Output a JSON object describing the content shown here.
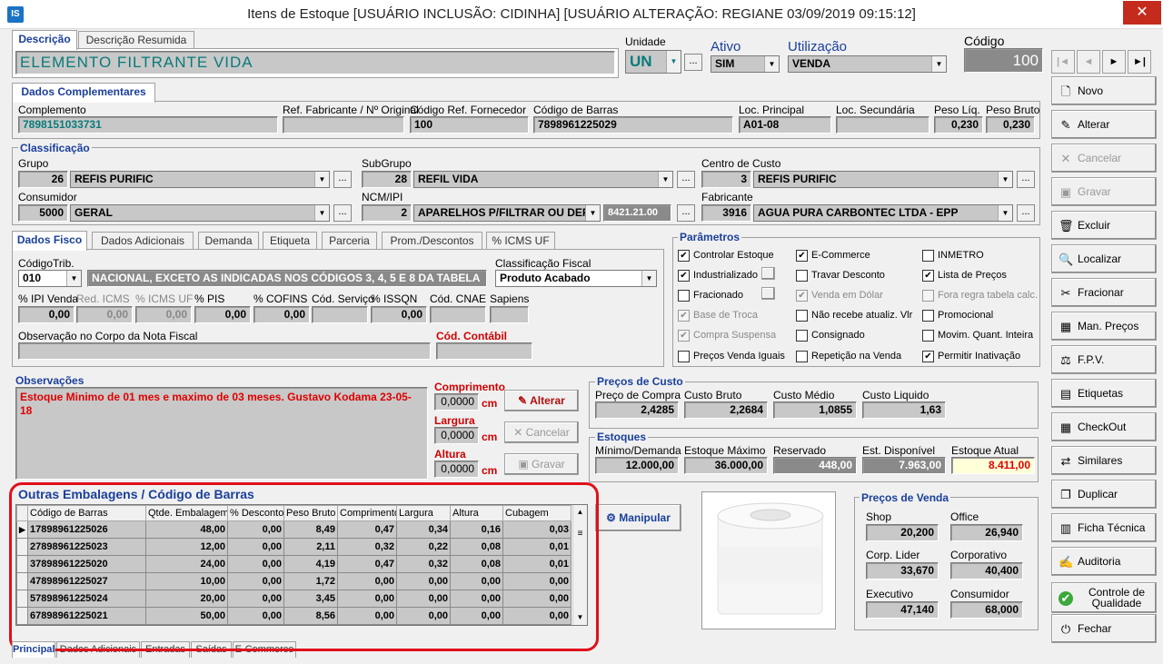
{
  "window": {
    "title": "Itens de Estoque  [USUÁRIO INCLUSÃO: CIDINHA]  [USUÁRIO ALTERAÇÃO: REGIANE 03/09/2019 09:15:12]",
    "icon_label": "IS",
    "close": "✕"
  },
  "header": {
    "tab_descricao": "Descrição",
    "tab_resumida": "Descrição Resumida",
    "descricao": "ELEMENTO FILTRANTE  VIDA",
    "unidade_label": "Unidade",
    "unidade": "UN",
    "ativo_label": "Ativo",
    "ativo": "SIM",
    "utilizacao_label": "Utilização",
    "utilizacao": "VENDA",
    "codigo_label": "Código",
    "codigo": "100",
    "dots": "..."
  },
  "nav": {
    "first": "|◄",
    "prev": "◄",
    "next": "►",
    "last": "►|"
  },
  "complementares": {
    "tab": "Dados Complementares",
    "complemento_label": "Complemento",
    "complemento": "7898151033731",
    "ref_fab_label": "Ref. Fabricante / Nº Original",
    "ref_fab": "",
    "cod_ref_label": "Código Ref. Fornecedor",
    "cod_ref": "100",
    "barras_label": "Código de Barras",
    "barras": "7898961225029",
    "loc_principal_label": "Loc. Principal",
    "loc_principal": "A01-08",
    "loc_secundaria_label": "Loc. Secundária",
    "loc_secundaria": "",
    "peso_liq_label": "Peso Líq.",
    "peso_liq": "0,230",
    "peso_bruto_label": "Peso Bruto",
    "peso_bruto": "0,230"
  },
  "classificacao": {
    "title": "Classificação",
    "grupo_label": "Grupo",
    "grupo_cod": "26",
    "grupo": "REFIS PURIFIC",
    "subgrupo_label": "SubGrupo",
    "subgrupo_cod": "28",
    "subgrupo": "REFIL VIDA",
    "centro_label": "Centro de Custo",
    "centro_cod": "3",
    "centro": "REFIS PURIFIC",
    "consumidor_label": "Consumidor",
    "consumidor_cod": "5000",
    "consumidor": "GERAL",
    "ncm_label": "NCM/IPI",
    "ncm_cod": "2",
    "ncm": "APARELHOS P/FILTRAR OU DEPURA",
    "ncm_num": "8421.21.00",
    "fabricante_label": "Fabricante",
    "fabricante_cod": "3916",
    "fabricante": "AGUA PURA CARBONTEC LTDA - EPP"
  },
  "fisco": {
    "tabs": [
      "Dados Fisco",
      "Dados Adicionais",
      "Demanda",
      "Etiqueta",
      "Parceria",
      "Prom./Descontos",
      "% ICMS UF"
    ],
    "cod_trib_label": "CódigoTrib.",
    "cod_trib": "010",
    "cod_trib_desc": "NACIONAL, EXCETO AS INDICADAS NOS CÓDIGOS 3, 4, 5 E 8 DA TABELA",
    "class_fiscal_label": "Classificação Fiscal",
    "class_fiscal": "Produto Acabado",
    "ipi_label": "% IPI Venda",
    "ipi": "0,00",
    "red_icms_label": "Red. ICMS",
    "red_icms": "0,00",
    "icms_uf_label": "% ICMS UF",
    "icms_uf": "0,00",
    "pis_label": "% PIS",
    "pis": "0,00",
    "cofins_label": "% COFINS",
    "cofins": "0,00",
    "cod_serv_label": "Cód. Serviço",
    "cod_serv": "",
    "issqn_label": "% ISSQN",
    "issqn": "0,00",
    "cnae_label": "Cód. CNAE",
    "cnae": "",
    "sapiens_label": "Sapiens",
    "sapiens": "",
    "obs_nf_label": "Observação no Corpo da Nota Fiscal",
    "obs_nf": "",
    "cod_contabil_label": "Cód. Contábil",
    "cod_contabil": ""
  },
  "parametros": {
    "title": "Parâmetros",
    "items": [
      {
        "label": "Controlar Estoque",
        "checked": true,
        "disabled": false
      },
      {
        "label": "E-Commerce",
        "checked": true,
        "disabled": false
      },
      {
        "label": "INMETRO",
        "checked": false,
        "disabled": false
      },
      {
        "label": "Industrializado",
        "checked": true,
        "disabled": false
      },
      {
        "label": "Travar Desconto",
        "checked": false,
        "disabled": false
      },
      {
        "label": "Lista de Preços",
        "checked": true,
        "disabled": false
      },
      {
        "label": "Fracionado",
        "checked": false,
        "disabled": false
      },
      {
        "label": "Venda em Dólar",
        "checked": true,
        "disabled": true
      },
      {
        "label": "Fora regra tabela calc.",
        "checked": false,
        "disabled": true
      },
      {
        "label": "Base de Troca",
        "checked": true,
        "disabled": true
      },
      {
        "label": "Não recebe atualiz. Vlr",
        "checked": false,
        "disabled": false
      },
      {
        "label": "Promocional",
        "checked": false,
        "disabled": false
      },
      {
        "label": "Compra Suspensa",
        "checked": true,
        "disabled": true
      },
      {
        "label": "Consignado",
        "checked": false,
        "disabled": false
      },
      {
        "label": "Movim. Quant. Inteira",
        "checked": false,
        "disabled": false
      },
      {
        "label": "Preços Venda Iguais",
        "checked": false,
        "disabled": false
      },
      {
        "label": "Repetição na Venda",
        "checked": false,
        "disabled": false
      },
      {
        "label": "Permitir Inativação",
        "checked": true,
        "disabled": false
      }
    ]
  },
  "observacoes": {
    "title": "Observações",
    "text": "Estoque Minimo de 01 mes e maximo de 03 meses. Gustavo Kodama 23-05-18"
  },
  "dimensoes": {
    "comprimento_label": "Comprimento",
    "comprimento": "0,0000",
    "largura_label": "Largura",
    "largura": "0,0000",
    "altura_label": "Altura",
    "altura": "0,0000",
    "unit": "cm",
    "alterar": "Alterar",
    "cancelar": "Cancelar",
    "gravar": "Gravar"
  },
  "custo": {
    "title": "Preços de Custo",
    "compra_label": "Preço de Compra",
    "compra": "2,4285",
    "bruto_label": "Custo Bruto",
    "bruto": "2,2684",
    "medio_label": "Custo Médio",
    "medio": "1,0855",
    "liquido_label": "Custo Liquido",
    "liquido": "1,63"
  },
  "estoques": {
    "title": "Estoques",
    "minimo_label": "Mínimo/Demanda",
    "minimo": "12.000,00",
    "maximo_label": "Estoque Máximo",
    "maximo": "36.000,00",
    "reservado_label": "Reservado",
    "reservado": "448,00",
    "disponivel_label": "Est. Disponível",
    "disponivel": "7.963,00",
    "atual_label": "Estoque Atual",
    "atual": "8.411,00"
  },
  "embalagens": {
    "title": "Outras Embalagens / Código de Barras",
    "columns": [
      "Código de Barras",
      "Qtde. Embalagem",
      "% Desconto",
      "Peso Bruto",
      "Comprimento",
      "Largura",
      "Altura",
      "Cubagem"
    ],
    "rows": [
      [
        "17898961225026",
        "48,00",
        "0,00",
        "8,49",
        "0,47",
        "0,34",
        "0,16",
        "0,03"
      ],
      [
        "27898961225023",
        "12,00",
        "0,00",
        "2,11",
        "0,32",
        "0,22",
        "0,08",
        "0,01"
      ],
      [
        "37898961225020",
        "24,00",
        "0,00",
        "4,19",
        "0,47",
        "0,32",
        "0,08",
        "0,01"
      ],
      [
        "47898961225027",
        "10,00",
        "0,00",
        "1,72",
        "0,00",
        "0,00",
        "0,00",
        "0,00"
      ],
      [
        "57898961225024",
        "20,00",
        "0,00",
        "3,45",
        "0,00",
        "0,00",
        "0,00",
        "0,00"
      ],
      [
        "67898961225021",
        "50,00",
        "0,00",
        "8,56",
        "0,00",
        "0,00",
        "0,00",
        "0,00"
      ]
    ],
    "manipular": "Manipular"
  },
  "precos_venda": {
    "title": "Preços de Venda",
    "shop_label": "Shop",
    "shop": "20,200",
    "office_label": "Office",
    "office": "26,940",
    "corp_lider_label": "Corp. Lider",
    "corp_lider": "33,670",
    "corporativo_label": "Corporativo",
    "corporativo": "40,400",
    "executivo_label": "Executivo",
    "executivo": "47,140",
    "consumidor_label": "Consumidor",
    "consumidor": "68,000"
  },
  "bottom_tabs": [
    "Principal",
    "Dados Adicionais",
    "Entradas",
    "Saídas",
    "E-Commerce"
  ],
  "sidebar": [
    {
      "label": "Novo",
      "icon": "document-icon",
      "glyph": "🗋",
      "disabled": false
    },
    {
      "label": "Alterar",
      "icon": "edit-icon",
      "glyph": "✎",
      "disabled": false
    },
    {
      "label": "Cancelar",
      "icon": "cancel-icon",
      "glyph": "✕",
      "disabled": true
    },
    {
      "label": "Gravar",
      "icon": "save-icon",
      "glyph": "▣",
      "disabled": true
    },
    {
      "label": "Excluir",
      "icon": "trash-icon",
      "glyph": "🗑",
      "disabled": false
    },
    {
      "label": "Localizar",
      "icon": "search-icon",
      "glyph": "🔍",
      "disabled": false
    },
    {
      "label": "Fracionar",
      "icon": "split-icon",
      "glyph": "✂",
      "disabled": false
    },
    {
      "label": "Man. Preços",
      "icon": "calculator-icon",
      "glyph": "▦",
      "disabled": false
    },
    {
      "label": "F.P.V.",
      "icon": "chart-icon",
      "glyph": "⚖",
      "disabled": false
    },
    {
      "label": "Etiquetas",
      "icon": "label-icon",
      "glyph": "▤",
      "disabled": false
    },
    {
      "label": "CheckOut",
      "icon": "grid-icon",
      "glyph": "▦",
      "disabled": false
    },
    {
      "label": "Similares",
      "icon": "similar-icon",
      "glyph": "⇄",
      "disabled": false
    },
    {
      "label": "Duplicar",
      "icon": "duplicate-icon",
      "glyph": "❐",
      "disabled": false
    },
    {
      "label": "Ficha Técnica",
      "icon": "sheet-icon",
      "glyph": "▥",
      "disabled": false
    },
    {
      "label": "Auditoria",
      "icon": "audit-icon",
      "glyph": "✍",
      "disabled": false
    },
    {
      "label": "Controle de Qualidade",
      "icon": "check-icon",
      "glyph": "✔",
      "disabled": false
    },
    {
      "label": "Fechar",
      "icon": "exit-icon",
      "glyph": "⏻",
      "disabled": false
    }
  ]
}
